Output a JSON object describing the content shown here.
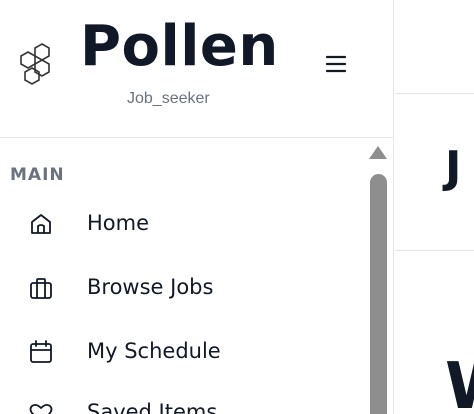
{
  "brand": {
    "name": "Pollen",
    "role": "Job_seeker"
  },
  "sidebar": {
    "section": "MAIN",
    "items": [
      {
        "label": "Home",
        "icon": "home-icon"
      },
      {
        "label": "Browse Jobs",
        "icon": "briefcase-icon"
      },
      {
        "label": "My Schedule",
        "icon": "calendar-icon"
      },
      {
        "label": "Saved Items",
        "icon": "heart-icon"
      }
    ]
  },
  "main": {
    "heading_partial": "J",
    "big_partial": "W"
  },
  "colors": {
    "text": "#111827",
    "muted": "#6b7280",
    "divider": "#e5e7eb",
    "scrollbar": "#8e8e8e"
  }
}
